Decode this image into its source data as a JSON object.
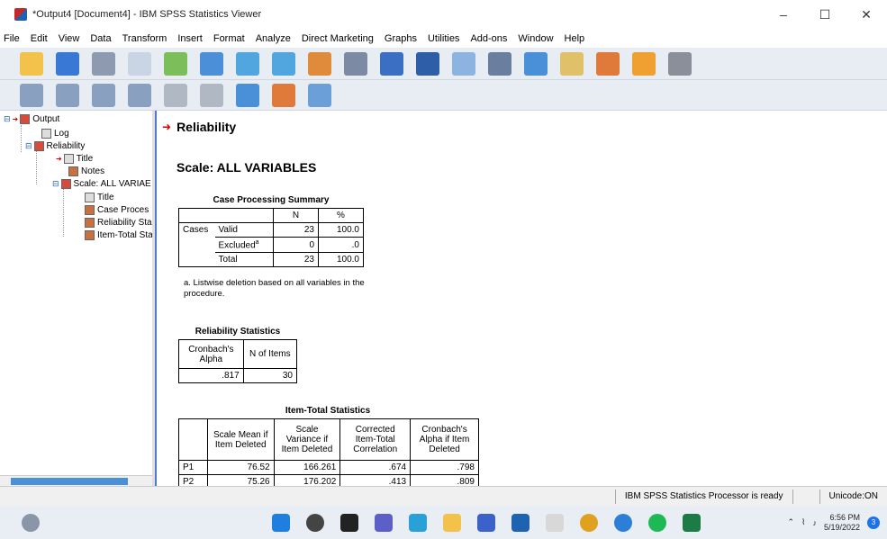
{
  "window": {
    "title": "*Output4 [Document4] - IBM SPSS Statistics Viewer",
    "minimize": "–",
    "maximize": "☐",
    "close": "✕"
  },
  "menu": [
    "File",
    "Edit",
    "View",
    "Data",
    "Transform",
    "Insert",
    "Format",
    "Analyze",
    "Direct Marketing",
    "Graphs",
    "Utilities",
    "Add-ons",
    "Window",
    "Help"
  ],
  "outline": {
    "output": "Output",
    "log": "Log",
    "reliability": "Reliability",
    "title": "Title",
    "notes": "Notes",
    "scale": "Scale: ALL VARIAE",
    "scale_title": "Title",
    "case_processing": "Case Proces",
    "reliability_stats": "Reliability Sta",
    "item_total": "Item-Total Sta"
  },
  "content": {
    "reliability_heading": "Reliability",
    "scale_heading": "Scale: ALL VARIABLES",
    "case_summary": {
      "title": "Case Processing Summary",
      "col_n": "N",
      "col_pct": "%",
      "row_group": "Cases",
      "rows": [
        {
          "label": "Valid",
          "n": "23",
          "pct": "100.0"
        },
        {
          "label": "Excluded",
          "sup": "a",
          "n": "0",
          "pct": ".0"
        },
        {
          "label": "Total",
          "n": "23",
          "pct": "100.0"
        }
      ],
      "footnote": "a. Listwise deletion based on all variables in the procedure."
    },
    "reliability_statistics": {
      "title": "Reliability Statistics",
      "col_alpha": "Cronbach's Alpha",
      "col_items": "N of Items",
      "alpha": ".817",
      "items": "30"
    },
    "item_total": {
      "title": "Item-Total Statistics",
      "headers": [
        "Scale Mean if Item Deleted",
        "Scale Variance if Item Deleted",
        "Corrected Item-Total Correlation",
        "Cronbach's Alpha if Item Deleted"
      ],
      "rows": [
        {
          "item": "P1",
          "mean": "76.52",
          "var": "166.261",
          "corr": ".674",
          "alpha": ".798"
        },
        {
          "item": "P2",
          "mean": "75.26",
          "var": "176.202",
          "corr": ".413",
          "alpha": ".809"
        }
      ]
    }
  },
  "status": {
    "processor": "IBM SPSS Statistics Processor is ready",
    "encoding": "Unicode:ON"
  },
  "taskbar": {
    "time": "6:56 PM",
    "date": "5/19/2022",
    "notifications": "3"
  }
}
